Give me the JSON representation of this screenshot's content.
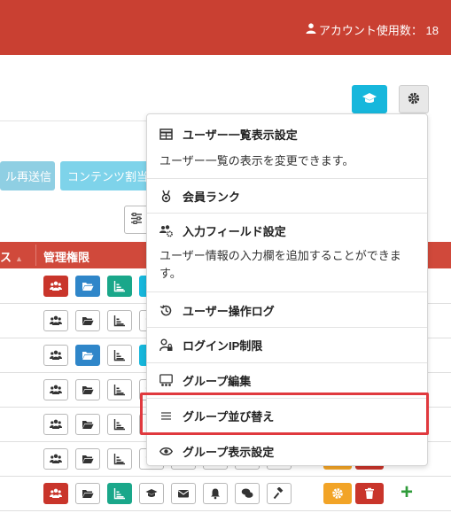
{
  "header": {
    "account_label": "アカウント使用数： 18"
  },
  "toolbar": {
    "resend_label": "ル再送信",
    "content_label": "コンテンツ割当"
  },
  "table": {
    "col_status": "ス",
    "col_admin": "管理権限",
    "rows": 7
  },
  "menu": {
    "items": [
      {
        "label": "ユーザー一覧表示設定",
        "icon": "table-icon",
        "desc": "ユーザー一覧の表示を変更できます。"
      },
      {
        "label": "会員ランク",
        "icon": "medal-icon"
      },
      {
        "label": "入力フィールド設定",
        "icon": "users-cog-icon",
        "desc": "ユーザー情報の入力欄を追加することができます。"
      },
      {
        "label": "ユーザー操作ログ",
        "icon": "history-icon"
      },
      {
        "label": "ログインIP制限",
        "icon": "user-lock-icon"
      },
      {
        "label": "グループ編集",
        "icon": "group-icon"
      },
      {
        "label": "グループ並び替え",
        "icon": "bars-icon"
      },
      {
        "label": "グループ表示設定",
        "icon": "eye-icon"
      }
    ]
  },
  "colors": {
    "brand_red": "#c94032",
    "cyan": "#17b7dc",
    "highlight": "#e0393e"
  }
}
